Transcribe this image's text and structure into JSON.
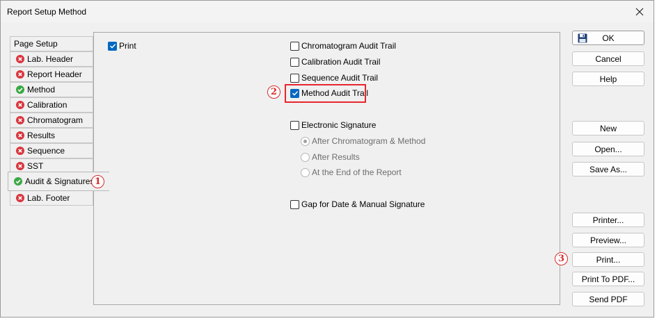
{
  "window": {
    "title": "Report Setup Method"
  },
  "tabs": [
    {
      "label": "Page Setup",
      "icon": ""
    },
    {
      "label": "Lab. Header",
      "icon": "error-icon"
    },
    {
      "label": "Report Header",
      "icon": "error-icon"
    },
    {
      "label": "Method",
      "icon": "check-icon"
    },
    {
      "label": "Calibration",
      "icon": "error-icon"
    },
    {
      "label": "Chromatogram",
      "icon": "error-icon"
    },
    {
      "label": "Results",
      "icon": "error-icon"
    },
    {
      "label": "Sequence",
      "icon": "error-icon"
    },
    {
      "label": "SST",
      "icon": "error-icon"
    },
    {
      "label": "Audit & Signatures",
      "icon": "check-icon",
      "selected": true
    },
    {
      "label": "Lab. Footer",
      "icon": "error-icon"
    }
  ],
  "panel": {
    "print": {
      "label": "Print",
      "checked": true
    },
    "chromatogram_audit": {
      "label": "Chromatogram Audit Trail",
      "checked": false
    },
    "calibration_audit": {
      "label": "Calibration Audit Trail",
      "checked": false
    },
    "sequence_audit": {
      "label": "Sequence Audit Trail",
      "checked": false
    },
    "method_audit": {
      "label": "Method Audit Trail",
      "checked": true
    },
    "electronic_signature": {
      "label": "Electronic Signature",
      "checked": false
    },
    "radio_after_chrom": {
      "label": "After Chromatogram & Method",
      "selected": true,
      "disabled": true
    },
    "radio_after_results": {
      "label": "After Results",
      "selected": false,
      "disabled": true
    },
    "radio_end_report": {
      "label": "At the End of the Report",
      "selected": false,
      "disabled": true
    },
    "gap_signature": {
      "label": "Gap for Date & Manual Signature",
      "checked": false
    }
  },
  "buttons": {
    "ok": "OK",
    "cancel": "Cancel",
    "help": "Help",
    "new": "New",
    "open": "Open...",
    "save_as": "Save As...",
    "printer": "Printer...",
    "preview": "Preview...",
    "print": "Print...",
    "print_pdf": "Print To PDF...",
    "send_pdf": "Send PDF"
  },
  "markers": {
    "m1": "1",
    "m2": "2",
    "m3": "3"
  },
  "colors": {
    "accent": "#0067c0",
    "error": "#d9363e",
    "success": "#3aa845",
    "annotation": "#e8262c"
  }
}
